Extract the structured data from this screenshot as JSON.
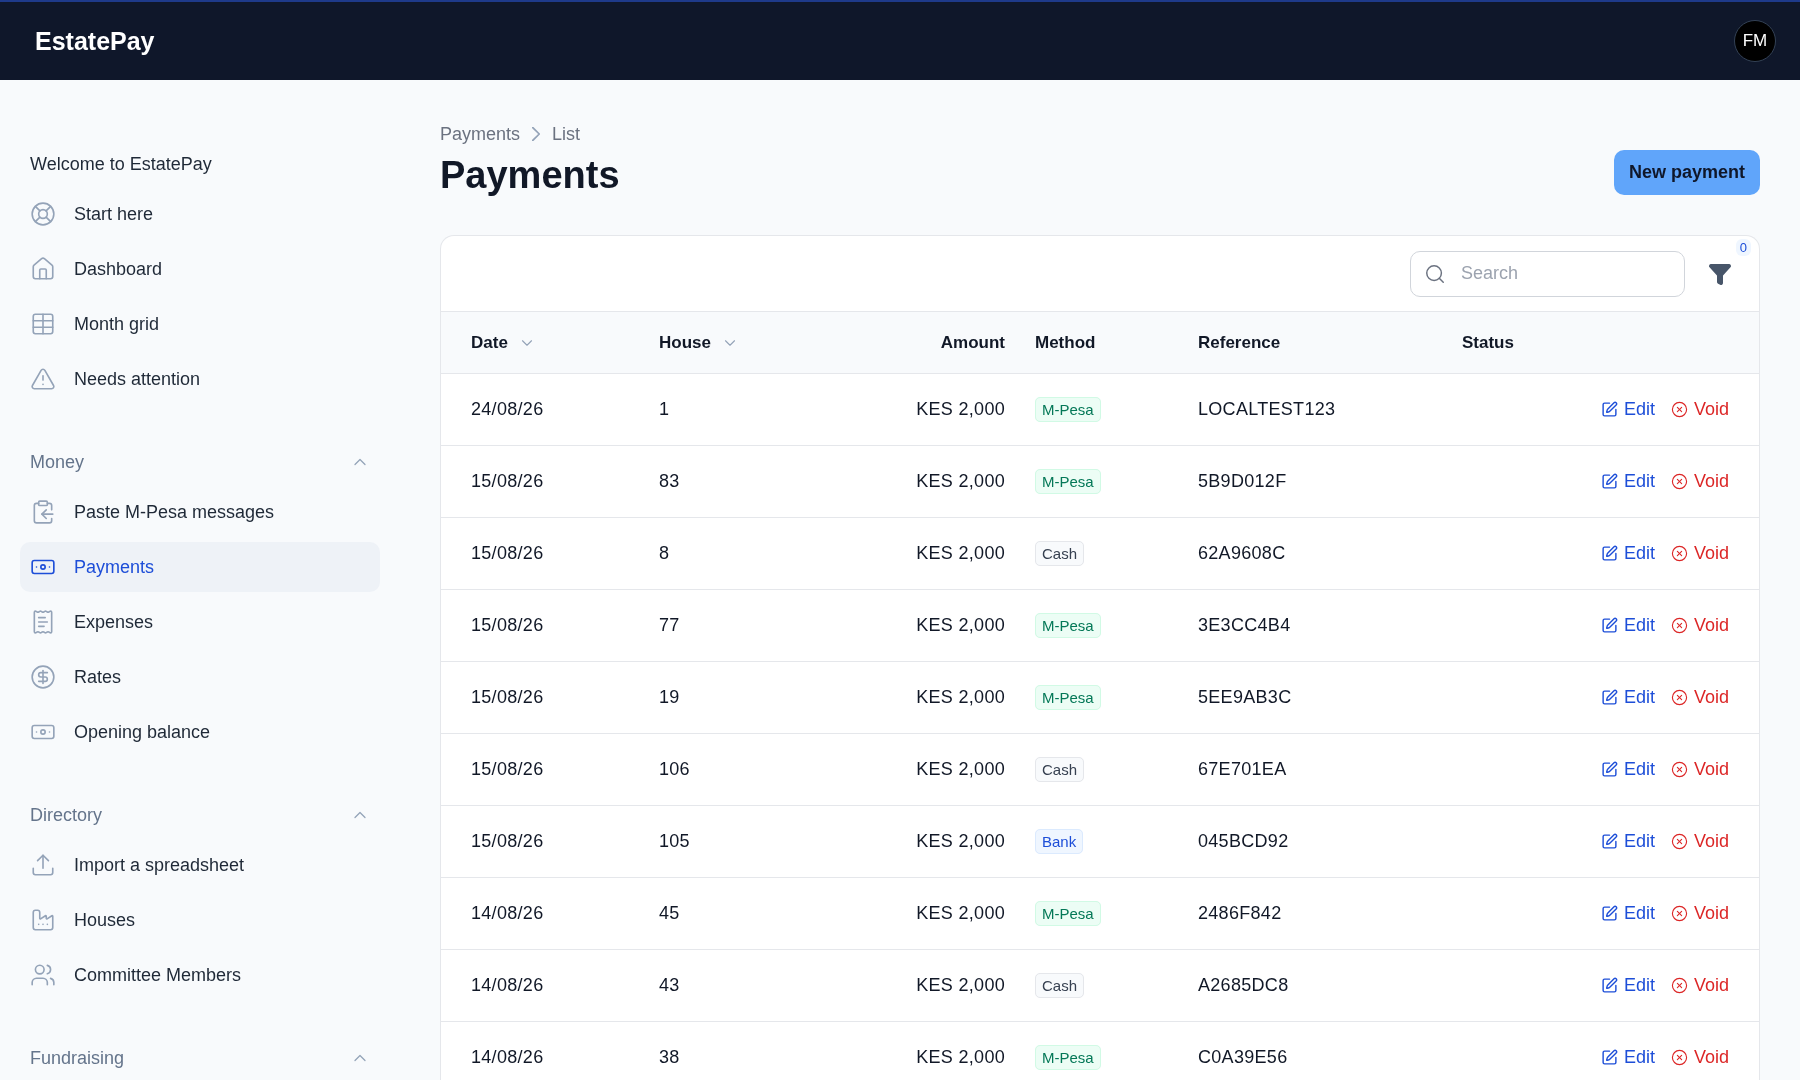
{
  "app": {
    "brand": "EstatePay",
    "avatar": "FM"
  },
  "sidebar": {
    "welcome": "Welcome to EstatePay",
    "items": [
      {
        "label": "Start here",
        "selected": false
      },
      {
        "label": "Dashboard",
        "selected": false
      },
      {
        "label": "Month grid",
        "selected": false
      },
      {
        "label": "Needs attention",
        "selected": false
      }
    ],
    "sections": [
      {
        "title": "Money",
        "expanded": true,
        "items": [
          {
            "label": "Paste M-Pesa messages",
            "selected": false
          },
          {
            "label": "Payments",
            "selected": true
          },
          {
            "label": "Expenses",
            "selected": false
          },
          {
            "label": "Rates",
            "selected": false
          },
          {
            "label": "Opening balance",
            "selected": false
          }
        ]
      },
      {
        "title": "Directory",
        "expanded": true,
        "items": [
          {
            "label": "Import a spreadsheet",
            "selected": false
          },
          {
            "label": "Houses",
            "selected": false
          },
          {
            "label": "Committee Members",
            "selected": false
          }
        ]
      },
      {
        "title": "Fundraising",
        "expanded": true
      }
    ]
  },
  "breadcrumb": [
    "Payments",
    "List"
  ],
  "title": "Payments",
  "new_button": "New payment",
  "search": {
    "placeholder": "Search"
  },
  "filter_count": "0",
  "table": {
    "columns": [
      {
        "label": "Date",
        "sortable": true
      },
      {
        "label": "House",
        "sortable": true
      },
      {
        "label": "Amount",
        "sortable": false
      },
      {
        "label": "Method",
        "sortable": false
      },
      {
        "label": "Reference",
        "sortable": false
      },
      {
        "label": "Status",
        "sortable": false
      }
    ],
    "rows": [
      {
        "date": "24/08/26",
        "house": "1",
        "amount": "KES 2,000",
        "method": {
          "label": "M-Pesa",
          "kind": "mpesa"
        },
        "reference": "LOCALTEST123",
        "edit": "Edit",
        "void": "Void"
      },
      {
        "date": "15/08/26",
        "house": "83",
        "amount": "KES 2,000",
        "method": {
          "label": "M-Pesa",
          "kind": "mpesa"
        },
        "reference": "5B9D012F",
        "edit": "Edit",
        "void": "Void"
      },
      {
        "date": "15/08/26",
        "house": "8",
        "amount": "KES 2,000",
        "method": {
          "label": "Cash",
          "kind": "cash"
        },
        "reference": "62A9608C",
        "edit": "Edit",
        "void": "Void"
      },
      {
        "date": "15/08/26",
        "house": "77",
        "amount": "KES 2,000",
        "method": {
          "label": "M-Pesa",
          "kind": "mpesa"
        },
        "reference": "3E3CC4B4",
        "edit": "Edit",
        "void": "Void"
      },
      {
        "date": "15/08/26",
        "house": "19",
        "amount": "KES 2,000",
        "method": {
          "label": "M-Pesa",
          "kind": "mpesa"
        },
        "reference": "5EE9AB3C",
        "edit": "Edit",
        "void": "Void"
      },
      {
        "date": "15/08/26",
        "house": "106",
        "amount": "KES 2,000",
        "method": {
          "label": "Cash",
          "kind": "cash"
        },
        "reference": "67E701EA",
        "edit": "Edit",
        "void": "Void"
      },
      {
        "date": "15/08/26",
        "house": "105",
        "amount": "KES 2,000",
        "method": {
          "label": "Bank",
          "kind": "bank"
        },
        "reference": "045BCD92",
        "edit": "Edit",
        "void": "Void"
      },
      {
        "date": "14/08/26",
        "house": "45",
        "amount": "KES 2,000",
        "method": {
          "label": "M-Pesa",
          "kind": "mpesa"
        },
        "reference": "2486F842",
        "edit": "Edit",
        "void": "Void"
      },
      {
        "date": "14/08/26",
        "house": "43",
        "amount": "KES 2,000",
        "method": {
          "label": "Cash",
          "kind": "cash"
        },
        "reference": "A2685DC8",
        "edit": "Edit",
        "void": "Void"
      },
      {
        "date": "14/08/26",
        "house": "38",
        "amount": "KES 2,000",
        "method": {
          "label": "M-Pesa",
          "kind": "mpesa"
        },
        "reference": "C0A39E56",
        "edit": "Edit",
        "void": "Void"
      }
    ]
  }
}
